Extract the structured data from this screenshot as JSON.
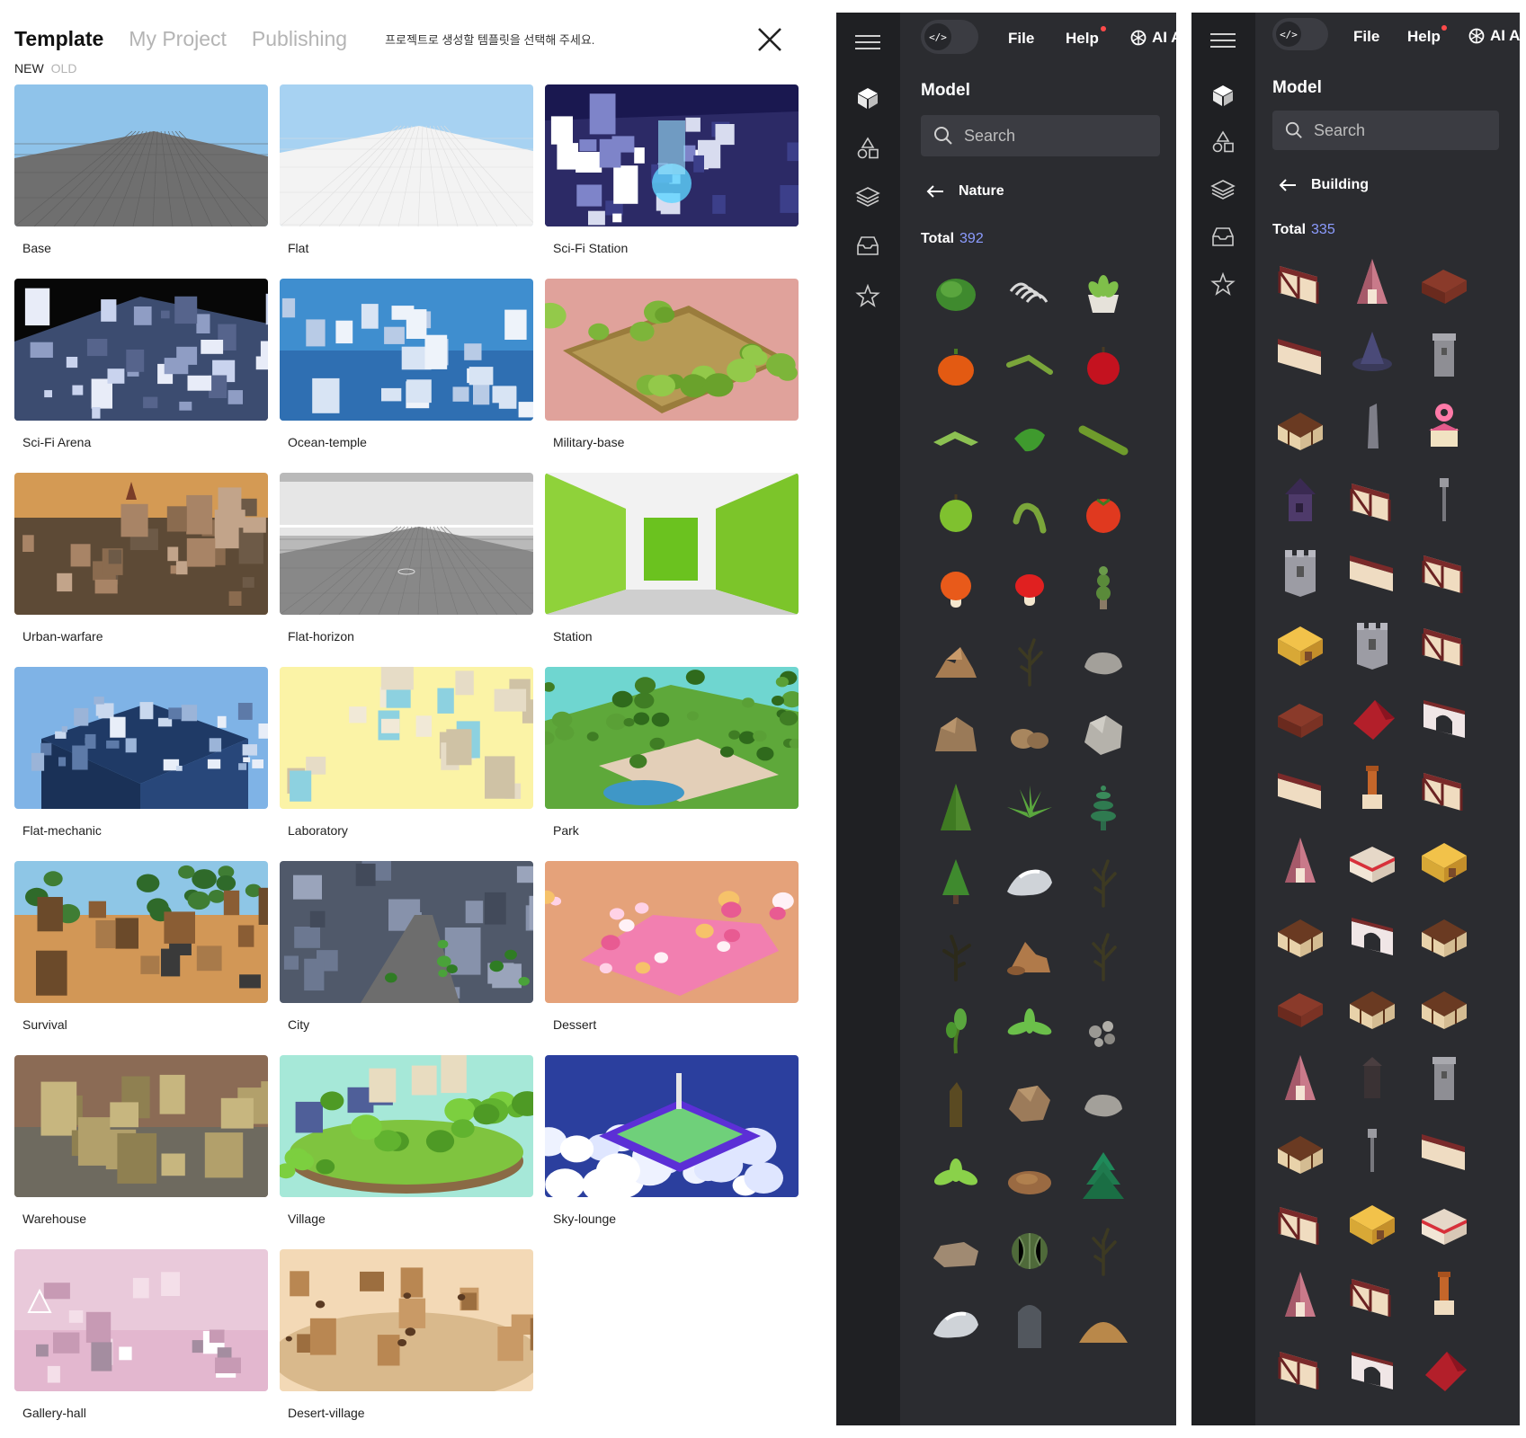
{
  "template_panel": {
    "tabs": [
      {
        "label": "Template",
        "active": true
      },
      {
        "label": "My Project",
        "active": false
      },
      {
        "label": "Publishing",
        "active": false
      }
    ],
    "hint": "프로젝트로 생성할 템플릿을 선택해 주세요.",
    "subtabs": [
      {
        "label": "NEW",
        "active": true
      },
      {
        "label": "OLD",
        "active": false
      }
    ],
    "templates": [
      {
        "name": "Base",
        "theme": "base"
      },
      {
        "name": "Flat",
        "theme": "flat"
      },
      {
        "name": "Sci-Fi Station",
        "theme": "scifi-station"
      },
      {
        "name": "Sci-Fi Arena",
        "theme": "scifi-arena"
      },
      {
        "name": "Ocean-temple",
        "theme": "ocean"
      },
      {
        "name": "Military-base",
        "theme": "military"
      },
      {
        "name": "Urban-warfare",
        "theme": "urban"
      },
      {
        "name": "Flat-horizon",
        "theme": "horizon"
      },
      {
        "name": "Station",
        "theme": "station"
      },
      {
        "name": "Flat-mechanic",
        "theme": "mechanic"
      },
      {
        "name": "Laboratory",
        "theme": "lab"
      },
      {
        "name": "Park",
        "theme": "park"
      },
      {
        "name": "Survival",
        "theme": "survival"
      },
      {
        "name": "City",
        "theme": "city"
      },
      {
        "name": "Dessert",
        "theme": "dessert"
      },
      {
        "name": "Warehouse",
        "theme": "warehouse"
      },
      {
        "name": "Village",
        "theme": "village"
      },
      {
        "name": "Sky-lounge",
        "theme": "sky"
      },
      {
        "name": "Gallery-hall",
        "theme": "gallery"
      },
      {
        "name": "Desert-village",
        "theme": "desert"
      }
    ]
  },
  "editor_left": {
    "menu": {
      "file": "File",
      "help": "Help",
      "ai": "AI A"
    },
    "section": "Model",
    "search_placeholder": "Search",
    "category": "Nature",
    "total_label": "Total",
    "total": "392",
    "items": [
      "bush",
      "ribs",
      "succulent-pot",
      "pumpkin",
      "branch",
      "apple-red",
      "leaf-angle",
      "leaf",
      "log",
      "apple-green",
      "vine",
      "tomato",
      "mushroom-orange",
      "mushroom-red",
      "topiary",
      "rock-pile",
      "dead-tree",
      "stone-gray",
      "boulder-brown",
      "rocks-brown",
      "boulder-gray",
      "pine",
      "agave",
      "spiral-tree",
      "pine-small",
      "snow-rock",
      "dead-tree",
      "dead-tree-dark",
      "rock-brown-pile",
      "dead-tree",
      "sapling",
      "fern",
      "pebbles",
      "stump",
      "rock-brown",
      "stone-gray",
      "fern-green",
      "dirt-mound",
      "pine-green",
      "rock-flat",
      "cactus-ball",
      "dead-tree",
      "snow-rock",
      "monolith",
      "sand-mound"
    ]
  },
  "editor_right": {
    "menu": {
      "file": "File",
      "help": "Help",
      "ai": "AI A"
    },
    "section": "Model",
    "search_placeholder": "Search",
    "category": "Building",
    "total_label": "Total",
    "total": "335",
    "items": [
      "wall-timber",
      "roof-pink",
      "cabin",
      "wall-panel",
      "witch-hat",
      "tower-gray",
      "house-timber",
      "obelisk",
      "donut-sign",
      "house-purple",
      "wall-timber",
      "lamp-post",
      "tower-castle",
      "wall-panel",
      "wall-timber",
      "house-yellow",
      "tower-castle",
      "wall-timber",
      "cabin",
      "roof-red",
      "arch",
      "wall-panel",
      "chimney",
      "wall-timber",
      "roof-pink",
      "shop",
      "house-yellow",
      "house-timber",
      "arch",
      "house-timber",
      "cabin",
      "house-timber",
      "house-timber",
      "roof-pink",
      "tower-dark",
      "tower-gray",
      "house-timber",
      "lamp-post",
      "wall-panel",
      "wall-timber",
      "house-yellow",
      "shop",
      "roof-pink",
      "wall-timber",
      "chimney",
      "wall-timber",
      "arch",
      "roof-red"
    ]
  }
}
